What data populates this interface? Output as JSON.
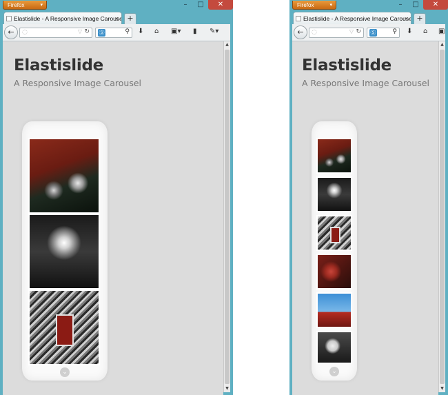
{
  "browser": {
    "app_button": "Firefox",
    "tab_title": "Elastislide - A Responsive Image Carousel",
    "new_tab": "+"
  },
  "page": {
    "title": "Elastislide",
    "subtitle": "A Responsive Image Carousel"
  },
  "left_window": {
    "thumbnails": [
      "flowers-photo",
      "buckle-photo",
      "red-box-photo"
    ]
  },
  "right_window": {
    "thumbnails": [
      "flowers-photo",
      "buckle-photo",
      "red-box-photo",
      "red-object-photo",
      "phone-booth-photo",
      "people-photo"
    ]
  }
}
